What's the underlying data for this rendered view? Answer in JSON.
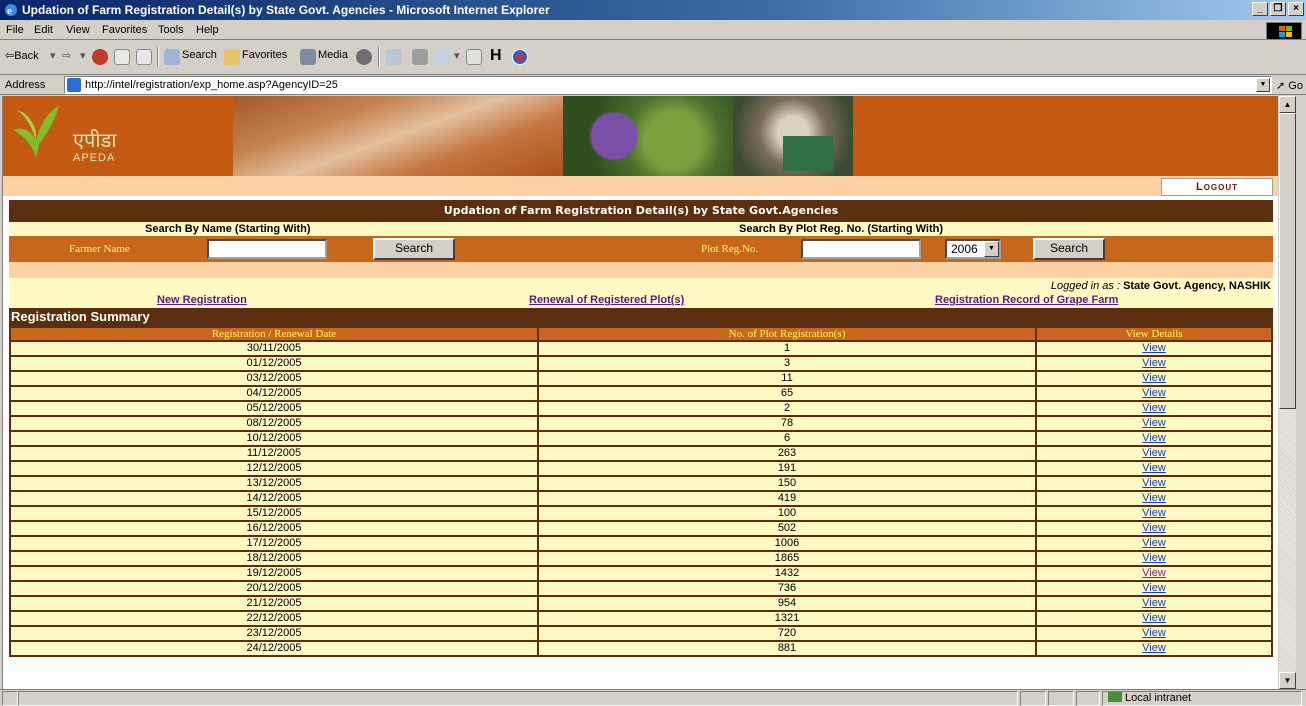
{
  "window": {
    "title": "Updation of Farm Registration Detail(s) by State Govt. Agencies - Microsoft Internet Explorer",
    "controls": [
      "_",
      "̱",
      "x"
    ]
  },
  "menu": [
    "File",
    "Edit",
    "View",
    "Favorites",
    "Tools",
    "Help"
  ],
  "toolbar": {
    "back": "⇦Back",
    "search": "Search",
    "favorites": "Favorites",
    "media": "Media"
  },
  "address": {
    "label": "Address",
    "url": "http://intel/registration/exp_home.asp?AgencyID=25",
    "go": "Go"
  },
  "banner": {
    "hindi": "एपीडा",
    "brand": "APEDA",
    "logout": "Logout"
  },
  "page": {
    "title": "Updation of Farm Registration Detail(s) by State Govt.Agencies",
    "search_name_heading": "Search By Name  (Starting With)",
    "search_plot_heading": "Search By Plot Reg. No.  (Starting With)",
    "farmer_label": "Farmer Name",
    "farmer_value": "",
    "search_btn": "Search",
    "plot_label": "Plot Reg.No.",
    "plot_value": "",
    "year": "2006",
    "logged_prefix": "Logged in as : ",
    "logged_user": "State Govt. Agency, NASHIK",
    "links": {
      "new_reg": "New Registration",
      "renewal": "Renewal of Registered Plot(s)",
      "record": "Registration Record of Grape Farm"
    },
    "summary_title": "Registration Summary"
  },
  "table": {
    "headers": [
      "Registration / Renewal Date",
      "No. of Plot Registration(s)",
      "View Details"
    ],
    "view_label": "View",
    "rows": [
      {
        "date": "30/11/2005",
        "count": "1"
      },
      {
        "date": "01/12/2005",
        "count": "3"
      },
      {
        "date": "03/12/2005",
        "count": "11"
      },
      {
        "date": "04/12/2005",
        "count": "65"
      },
      {
        "date": "05/12/2005",
        "count": "2"
      },
      {
        "date": "08/12/2005",
        "count": "78"
      },
      {
        "date": "10/12/2005",
        "count": "6"
      },
      {
        "date": "11/12/2005",
        "count": "263"
      },
      {
        "date": "12/12/2005",
        "count": "191"
      },
      {
        "date": "13/12/2005",
        "count": "150"
      },
      {
        "date": "14/12/2005",
        "count": "419"
      },
      {
        "date": "15/12/2005",
        "count": "100"
      },
      {
        "date": "16/12/2005",
        "count": "502"
      },
      {
        "date": "17/12/2005",
        "count": "1006"
      },
      {
        "date": "18/12/2005",
        "count": "1865"
      },
      {
        "date": "19/12/2005",
        "count": "1432",
        "visited": true
      },
      {
        "date": "20/12/2005",
        "count": "736"
      },
      {
        "date": "21/12/2005",
        "count": "954"
      },
      {
        "date": "22/12/2005",
        "count": "1321"
      },
      {
        "date": "23/12/2005",
        "count": "720"
      },
      {
        "date": "24/12/2005",
        "count": "881"
      }
    ]
  },
  "status": {
    "zone": "Local intranet"
  }
}
